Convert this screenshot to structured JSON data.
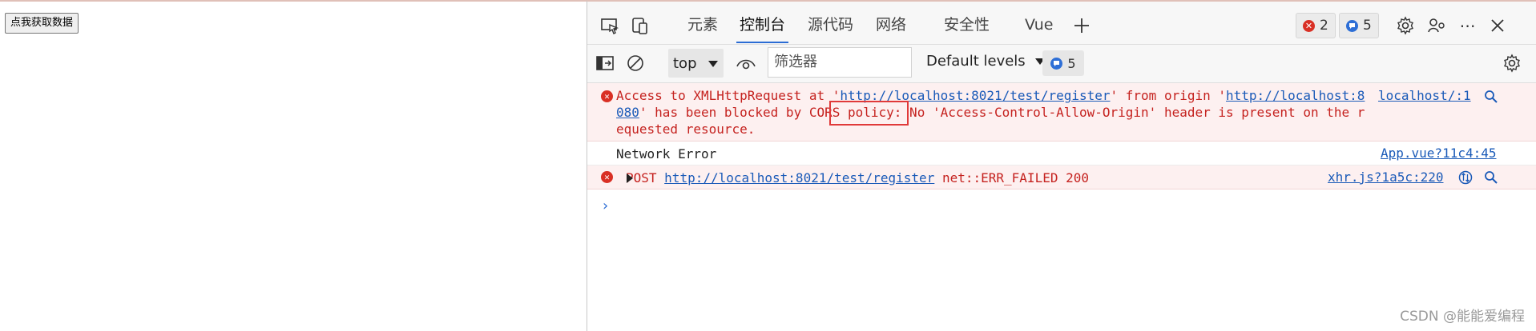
{
  "page": {
    "fetch_button_label": "点我获取数据"
  },
  "devtools": {
    "tabs": [
      {
        "label": "元素",
        "active": false
      },
      {
        "label": "控制台",
        "active": true
      },
      {
        "label": "源代码",
        "active": false
      },
      {
        "label": "网络",
        "active": false
      },
      {
        "label": "安全性",
        "active": false
      },
      {
        "label": "Vue",
        "active": false
      }
    ],
    "error_count": "2",
    "message_count": "5",
    "toolbar": {
      "context": "top",
      "filter_placeholder": "筛选器",
      "levels_label": "Default levels",
      "messages_count": "5"
    },
    "console": {
      "cors_error": {
        "t1": "Access to XMLHttpRequest at '",
        "url1": "http://localhost:8021/test/register",
        "t2": "' from origin '",
        "url2": "http://localhost:8080",
        "t3": "' has been blocked by CORS policy: No 'Access-Control-Allow-Origin' header is present on the requested resource.",
        "source": "localhost/:1"
      },
      "network_error": {
        "text": "Network Error",
        "source": "App.vue?11c4:45"
      },
      "post_error": {
        "method": "POST",
        "url": "http://localhost:8021/test/register",
        "status": "net::ERR_FAILED 200",
        "source": "xhr.js?1a5c:220"
      }
    },
    "colors": {
      "accent": "#2b6cd4",
      "error": "#c5221f",
      "error_bg": "#fdf0f0",
      "highlight_box": "#e03a3a"
    }
  },
  "watermark": "CSDN @能能爱编程"
}
